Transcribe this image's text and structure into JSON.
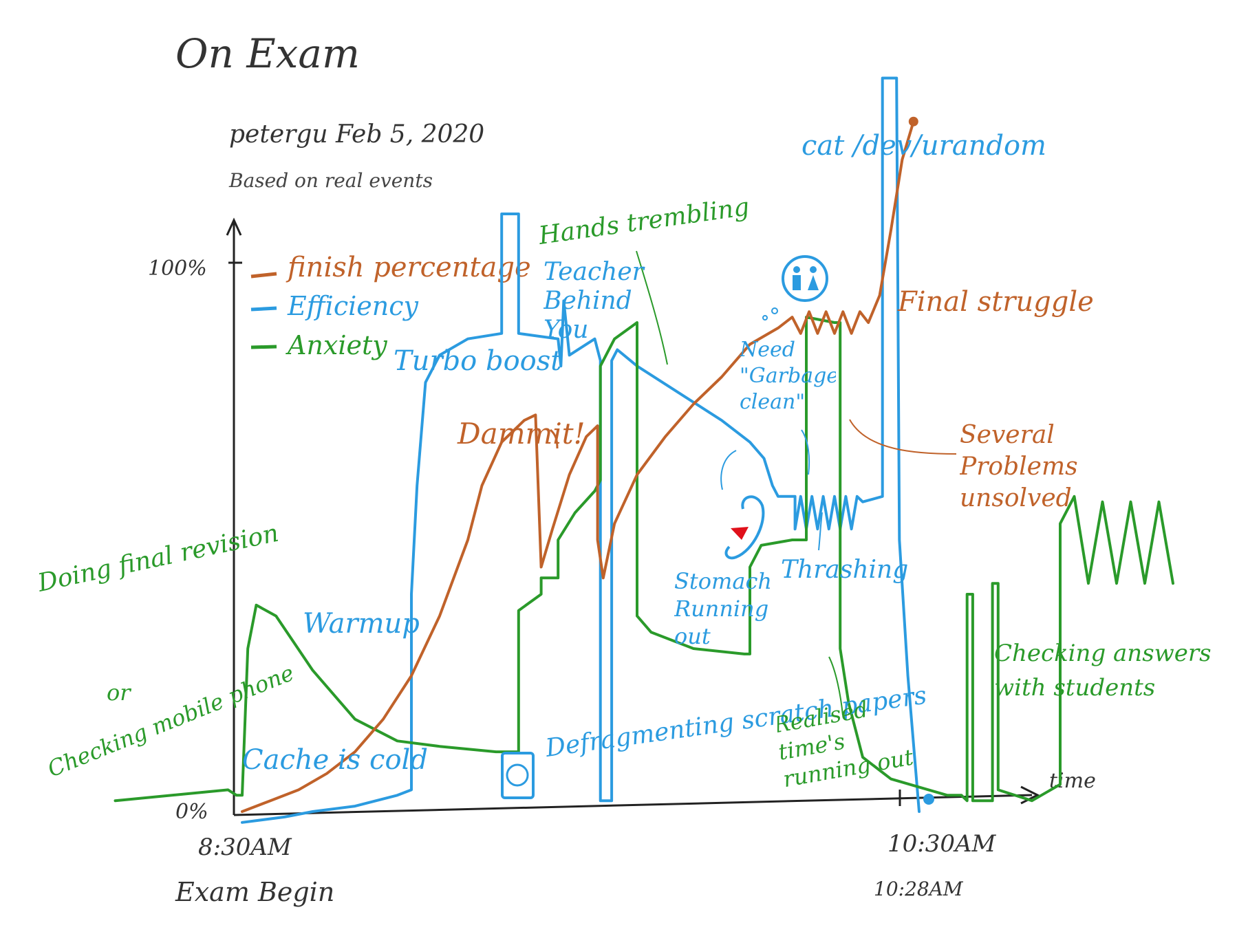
{
  "chart_data": {
    "type": "line",
    "title": "On Exam",
    "subtitle": "petergu   Feb 5, 2020",
    "note": "Based on real events",
    "ylabel_top": "100%",
    "ylabel_bottom": "0%",
    "xlabel": "time",
    "x_ticks": [
      {
        "label": "8:30AM",
        "sublabel": "Exam Begin"
      },
      {
        "label": "10:30AM",
        "sublabel": "10:28AM"
      }
    ],
    "ylim": [
      0,
      100
    ],
    "legend": {
      "placement": "top-left",
      "entries": [
        {
          "name": "finish percentage",
          "color": "#c0622a"
        },
        {
          "name": "Efficiency",
          "color": "#2b9be0"
        },
        {
          "name": "Anxiety",
          "color": "#2a9a2a"
        }
      ]
    },
    "x_units": "minutes from 8:30AM",
    "series": [
      {
        "name": "finish percentage",
        "color": "#c0622a",
        "points": [
          [
            0,
            0
          ],
          [
            10,
            2
          ],
          [
            20,
            4
          ],
          [
            30,
            7
          ],
          [
            40,
            11
          ],
          [
            50,
            17
          ],
          [
            60,
            25
          ],
          [
            70,
            36
          ],
          [
            80,
            50
          ],
          [
            85,
            60
          ],
          [
            92,
            68
          ],
          [
            100,
            72
          ],
          [
            104,
            73
          ],
          [
            106,
            45
          ],
          [
            110,
            52
          ],
          [
            116,
            62
          ],
          [
            122,
            69
          ],
          [
            126,
            71
          ],
          [
            126,
            50
          ],
          [
            128,
            43
          ],
          [
            132,
            53
          ],
          [
            140,
            62
          ],
          [
            150,
            69
          ],
          [
            160,
            75
          ],
          [
            170,
            80
          ],
          [
            180,
            86
          ],
          [
            190,
            89
          ],
          [
            195,
            91
          ],
          [
            198,
            88
          ],
          [
            201,
            92
          ],
          [
            204,
            88
          ],
          [
            207,
            92
          ],
          [
            210,
            88
          ],
          [
            213,
            92
          ],
          [
            216,
            88
          ],
          [
            219,
            92
          ],
          [
            222,
            90
          ],
          [
            226,
            95
          ],
          [
            230,
            107
          ],
          [
            234,
            120
          ],
          [
            238,
            127
          ]
        ]
      },
      {
        "name": "Efficiency",
        "color": "#2b9be0",
        "points": [
          [
            0,
            -2
          ],
          [
            15,
            -1
          ],
          [
            25,
            0
          ],
          [
            40,
            1
          ],
          [
            55,
            3
          ],
          [
            60,
            4
          ],
          [
            60,
            40
          ],
          [
            62,
            60
          ],
          [
            65,
            79
          ],
          [
            70,
            84
          ],
          [
            80,
            87
          ],
          [
            92,
            88
          ],
          [
            92,
            110
          ],
          [
            98,
            110
          ],
          [
            98,
            88
          ],
          [
            112,
            87
          ],
          [
            113,
            82
          ],
          [
            114,
            94
          ],
          [
            116,
            84
          ],
          [
            125,
            87
          ],
          [
            127,
            83
          ],
          [
            127,
            2
          ],
          [
            131,
            2
          ],
          [
            131,
            83
          ],
          [
            133,
            85
          ],
          [
            140,
            82
          ],
          [
            155,
            77
          ],
          [
            170,
            72
          ],
          [
            180,
            68
          ],
          [
            185,
            65
          ],
          [
            188,
            60
          ],
          [
            190,
            58
          ],
          [
            196,
            58
          ],
          [
            196,
            52
          ],
          [
            198,
            58
          ],
          [
            200,
            52
          ],
          [
            202,
            58
          ],
          [
            204,
            52
          ],
          [
            206,
            58
          ],
          [
            208,
            52
          ],
          [
            210,
            58
          ],
          [
            212,
            52
          ],
          [
            214,
            58
          ],
          [
            216,
            52
          ],
          [
            218,
            58
          ],
          [
            220,
            57
          ],
          [
            227,
            58
          ],
          [
            227,
            135
          ],
          [
            232,
            135
          ],
          [
            233,
            50
          ],
          [
            236,
            25
          ],
          [
            240,
            0
          ]
        ]
      },
      {
        "name": "Anxiety",
        "color": "#2a9a2a",
        "points": [
          [
            -45,
            2
          ],
          [
            -5,
            4
          ],
          [
            -2,
            3
          ],
          [
            0,
            3
          ],
          [
            2,
            30
          ],
          [
            5,
            38
          ],
          [
            12,
            36
          ],
          [
            25,
            26
          ],
          [
            40,
            17
          ],
          [
            55,
            13
          ],
          [
            70,
            12
          ],
          [
            90,
            11
          ],
          [
            98,
            11
          ],
          [
            98,
            37
          ],
          [
            106,
            40
          ],
          [
            106,
            43
          ],
          [
            112,
            43
          ],
          [
            112,
            50
          ],
          [
            118,
            55
          ],
          [
            125,
            59
          ],
          [
            127,
            61
          ],
          [
            127,
            82
          ],
          [
            132,
            87
          ],
          [
            140,
            90
          ],
          [
            140,
            36
          ],
          [
            145,
            33
          ],
          [
            160,
            30
          ],
          [
            178,
            29
          ],
          [
            180,
            29
          ],
          [
            180,
            45
          ],
          [
            184,
            49
          ],
          [
            195,
            50
          ],
          [
            200,
            50
          ],
          [
            200,
            91
          ],
          [
            210,
            90
          ],
          [
            212,
            90
          ],
          [
            212,
            30
          ],
          [
            215,
            20
          ],
          [
            220,
            10
          ],
          [
            230,
            6
          ],
          [
            250,
            3
          ],
          [
            255,
            3
          ],
          [
            257,
            2
          ],
          [
            257,
            40
          ],
          [
            259,
            40
          ],
          [
            259,
            2
          ],
          [
            266,
            2
          ],
          [
            266,
            42
          ],
          [
            268,
            42
          ],
          [
            268,
            4
          ],
          [
            280,
            2
          ],
          [
            290,
            5
          ],
          [
            290,
            53
          ],
          [
            295,
            58
          ],
          [
            300,
            42
          ],
          [
            305,
            57
          ],
          [
            310,
            42
          ],
          [
            315,
            57
          ],
          [
            320,
            42
          ],
          [
            325,
            57
          ],
          [
            330,
            42
          ]
        ]
      }
    ],
    "annotations": [
      {
        "text": "Doing final revision",
        "color": "#2a9a2a"
      },
      {
        "text": "or",
        "color": "#2a9a2a"
      },
      {
        "text": "Checking mobile phone",
        "color": "#2a9a2a"
      },
      {
        "text": "Warmup",
        "color": "#2b9be0"
      },
      {
        "text": "Cache is cold",
        "color": "#2b9be0"
      },
      {
        "text": "Turbo boost",
        "color": "#2b9be0"
      },
      {
        "text": "Teacher Behind You",
        "color": "#2b9be0"
      },
      {
        "text": "Hands trembling",
        "color": "#2a9a2a"
      },
      {
        "text": "Dammit!",
        "color": "#c0622a"
      },
      {
        "text": "Defragmenting scratch papers",
        "color": "#2b9be0"
      },
      {
        "text": "Stomach Running out",
        "color": "#2b9be0"
      },
      {
        "text": "Need \"Garbage clean\"",
        "color": "#2b9be0"
      },
      {
        "text": "Thrashing",
        "color": "#2b9be0"
      },
      {
        "text": "cat /dev/urandom",
        "color": "#2b9be0"
      },
      {
        "text": "Final struggle",
        "color": "#c0622a"
      },
      {
        "text": "Several Problems unsolved",
        "color": "#c0622a"
      },
      {
        "text": "Realised time's running out",
        "color": "#2a9a2a"
      },
      {
        "text": "Checking answers with students",
        "color": "#2a9a2a"
      }
    ]
  }
}
